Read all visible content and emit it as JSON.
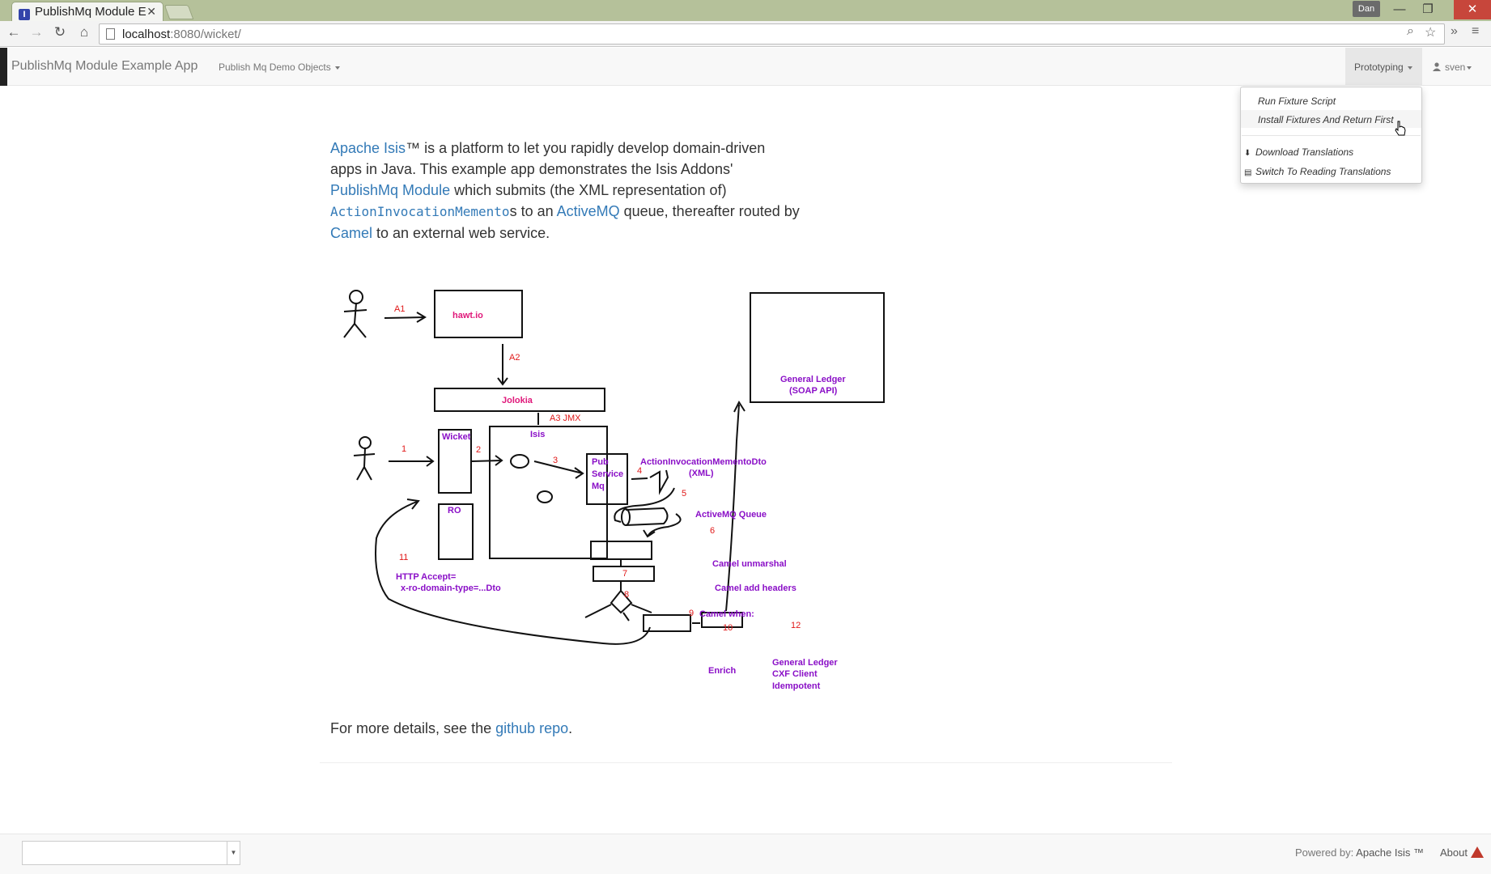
{
  "browser": {
    "tab_title": "PublishMq Module E",
    "tab_favicon": "I",
    "profile_user": "Dan",
    "url_host": "localhost",
    "url_rest": ":8080/wicket/"
  },
  "navbar": {
    "brand": "PublishMq Module Example App",
    "menu_objects": "Publish Mq Demo Objects",
    "menu_prototyping": "Prototyping",
    "menu_user": "sven"
  },
  "dropdown": {
    "items": [
      "Run Fixture Script",
      "Install Fixtures And Return First",
      "Download Translations",
      "Switch To Reading Translations"
    ]
  },
  "intro": {
    "link_isis": "Apache Isis",
    "t1": "™ is a platform to let you rapidly develop domain-driven apps in Java. This example app demonstrates the Isis Addons' ",
    "link_module": "PublishMq Module",
    "t2": " which submits (the XML representation of) ",
    "code_memento": "ActionInvocationMemento",
    "t3": "s to an ",
    "link_activemq": "ActiveMQ",
    "t4": " queue, thereafter routed by ",
    "link_camel": "Camel",
    "t5": " to an external web service."
  },
  "diagram": {
    "labels": {
      "hawtio": "hawt.io",
      "jolokia": "Jolokia",
      "a1": "A1",
      "a2": "A2",
      "a3": "A3 JMX",
      "wicket": "Wicket",
      "isis": "Isis",
      "ro": "RO",
      "pub1": "Pub",
      "pub2": "Service",
      "pub3": "Mq",
      "dto": "ActionInvocationMementoDto",
      "xml": "(XML)",
      "queue": "ActiveMQ Queue",
      "unmarshal": "Camel unmarshal",
      "headers": "Camel add headers",
      "when": "Camel when:",
      "enrich": "Enrich",
      "gl1": "General Ledger",
      "gl2": "(SOAP API)",
      "glc1": "General Ledger",
      "glc2": "CXF Client",
      "glc3": "Idempotent",
      "http1": "HTTP Accept=",
      "http2": "x-ro-domain-type=...Dto",
      "n1": "1",
      "n2": "2",
      "n3": "3",
      "n4": "4",
      "n5": "5",
      "n6": "6",
      "n7": "7",
      "n8": "8",
      "n9": "9",
      "n10": "10",
      "n11": "11",
      "n12": "12"
    }
  },
  "more": {
    "t1": "For more details, see the ",
    "link": "github repo",
    "t2": "."
  },
  "footer": {
    "powered_by": "Powered by:",
    "powered_name": "Apache Isis ™",
    "about": "About"
  }
}
